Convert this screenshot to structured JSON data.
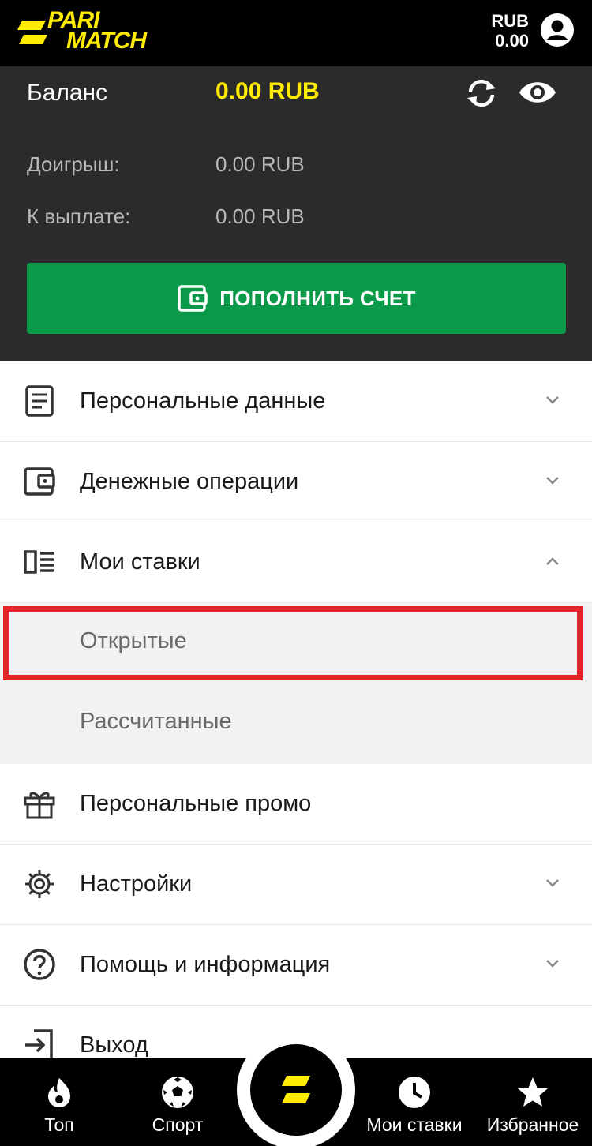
{
  "header": {
    "logo_line1": "PARI",
    "logo_line2": "MATCH",
    "currency": "RUB",
    "amount": "0.00"
  },
  "balance": {
    "label": "Баланс",
    "value": "0.00 RUB",
    "rows": [
      {
        "label": "Доигрыш:",
        "value": "0.00 RUB"
      },
      {
        "label": "К выплате:",
        "value": "0.00 RUB"
      }
    ],
    "deposit_label": "ПОПОЛНИТЬ СЧЕТ"
  },
  "menu": {
    "personal_data": "Персональные данные",
    "money_ops": "Денежные операции",
    "my_bets": "Мои ставки",
    "open": "Открытые",
    "settled": "Рассчитанные",
    "promo": "Персональные промо",
    "settings": "Настройки",
    "help": "Помощь и информация",
    "logout": "Выход"
  },
  "nav": {
    "top": "Топ",
    "sport": "Спорт",
    "my_bets": "Мои ставки",
    "favorites": "Избранное"
  },
  "colors": {
    "brand_yellow": "#ffec00",
    "deposit_green": "#0b9a4a",
    "highlight_red": "#e3242b"
  }
}
